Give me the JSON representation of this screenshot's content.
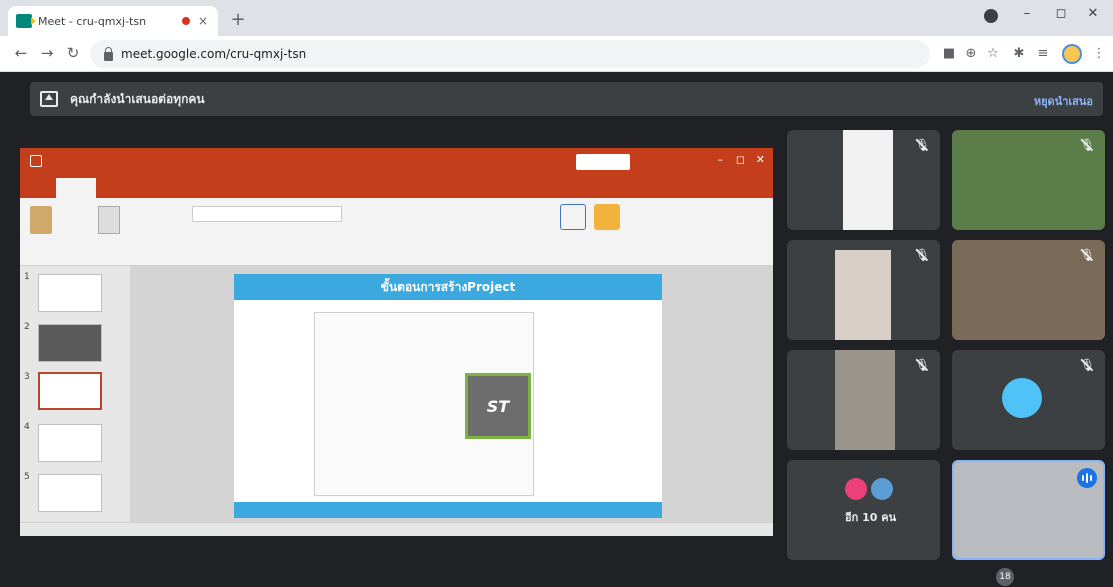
{
  "browser": {
    "tab_title": "Meet - cru-qmxj-tsn",
    "tab_close": "×",
    "new_tab": "+",
    "url": "meet.google.com/cru-qmxj-tsn",
    "window_controls": {
      "minimize": "–",
      "maximize": "◻",
      "close": "✕"
    },
    "nav": {
      "back": "←",
      "forward": "→",
      "reload": "↻"
    },
    "toolbar_icons": [
      "camera-icon",
      "zoom-icon",
      "star-icon",
      "extensions-icon",
      "reading-list-icon"
    ],
    "menu": "⋮"
  },
  "meet": {
    "presenting_text": "คุณกำลังนำเสนอต่อทุกคน",
    "stop_presenting": "หยุดนำเสนอ",
    "others_count_label": "อีก 10 คน",
    "participants_badge": "18"
  },
  "shared_screen": {
    "app": "PowerPoint",
    "slide_title": "ขั้นตอนการสร้างProject",
    "thumbnail_numbers": [
      "1",
      "2",
      "3",
      "4",
      "5"
    ],
    "active_slide_index": 3,
    "chip_logo": "ST"
  },
  "participants": [
    {
      "id": "p1",
      "name": "",
      "muted": true
    },
    {
      "id": "p2",
      "name": "",
      "muted": true
    },
    {
      "id": "p3",
      "name": "",
      "muted": true
    },
    {
      "id": "p4",
      "name": "",
      "muted": true
    },
    {
      "id": "p5",
      "name": "",
      "muted": true
    },
    {
      "id": "p6",
      "name": "",
      "muted": true
    },
    {
      "id": "others",
      "name": "อีก 10 คน"
    },
    {
      "id": "self",
      "name": "",
      "speaking": true
    }
  ],
  "colors": {
    "meet_bg": "#202124",
    "tile_bg": "#3c4043",
    "ppt_accent": "#c43e1c",
    "slide_accent": "#3ba9e0",
    "speaking_blue": "#1a73e8"
  }
}
